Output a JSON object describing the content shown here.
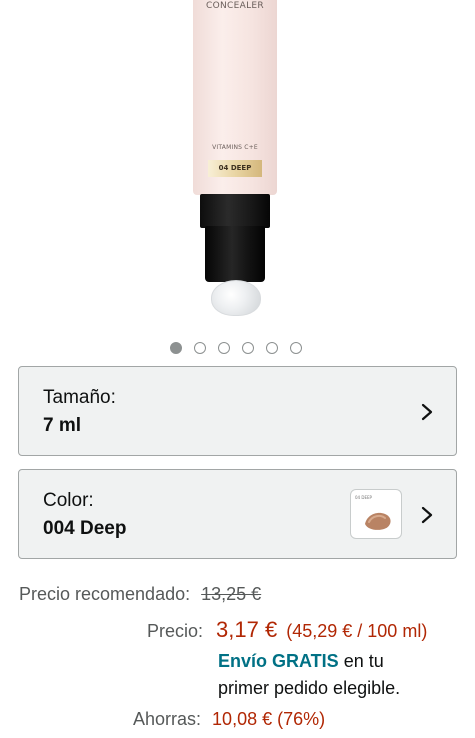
{
  "product_image": {
    "brand_text": "CONCEALER",
    "vitamins_text": "VITAMINS C+E",
    "shade_text": "04 DEEP",
    "carousel_count": 6,
    "carousel_active_index": 0
  },
  "size_selector": {
    "label": "Tamaño:",
    "value": "7 ml"
  },
  "color_selector": {
    "label": "Color:",
    "value": "004 Deep",
    "swatch_text": "04 DEEP"
  },
  "pricing": {
    "recommended_label": "Precio recomendado:",
    "recommended_value": "13,25 €",
    "price_label": "Precio:",
    "price_value": "3,17 €",
    "unit_price": "(45,29 € / 100 ml)",
    "shipping_highlight": "Envío GRATIS",
    "shipping_line1_rest": " en tu",
    "shipping_line2": "primer pedido elegible.",
    "savings_label": "Ahorras:",
    "savings_value": "10,08 € (76%)"
  },
  "colors": {
    "price_red": "#b12704",
    "link_teal": "#007185",
    "selector_bg": "#f0f2f2"
  }
}
